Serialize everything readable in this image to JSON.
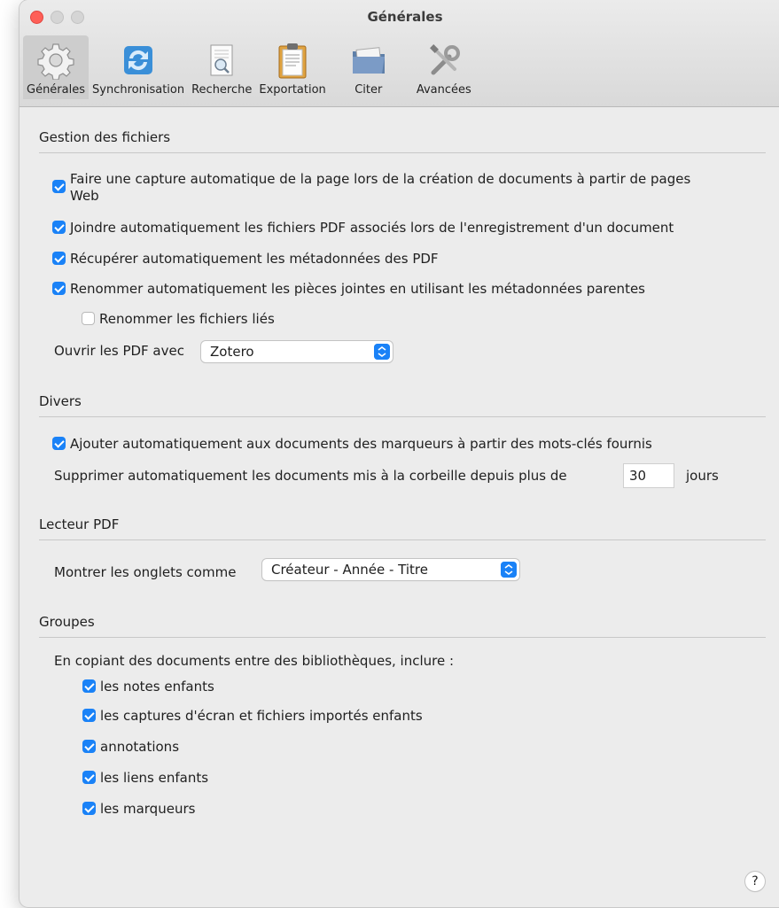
{
  "window": {
    "title": "Générales"
  },
  "toolbar": {
    "items": [
      {
        "label": "Générales",
        "icon": "gear-icon"
      },
      {
        "label": "Synchronisation",
        "icon": "sync-icon"
      },
      {
        "label": "Recherche",
        "icon": "search-document-icon"
      },
      {
        "label": "Exportation",
        "icon": "clipboard-icon"
      },
      {
        "label": "Citer",
        "icon": "folder-icon"
      },
      {
        "label": "Avancées",
        "icon": "tools-icon"
      }
    ]
  },
  "file_management": {
    "title": "Gestion des fichiers",
    "snapshot_line1": "Faire une capture automatique de la page lors de la création de documents à partir de pages",
    "snapshot_line2": "Web",
    "attach_pdf": "Joindre automatiquement les fichiers PDF associés lors de l'enregistrement d'un document",
    "retrieve_metadata": "Récupérer automatiquement les métadonnées des PDF",
    "rename_attachments": "Renommer automatiquement les pièces jointes en utilisant les métadonnées parentes",
    "rename_linked": "Renommer les fichiers liés",
    "open_pdf_label": "Ouvrir les PDF avec",
    "open_pdf_value": "Zotero"
  },
  "misc": {
    "title": "Divers",
    "auto_tags": "Ajouter automatiquement aux documents des marqueurs à partir des mots-clés fournis",
    "trash_prefix": "Supprimer automatiquement les documents mis à la corbeille depuis plus de",
    "trash_days": "30",
    "trash_suffix": "jours"
  },
  "pdf_reader": {
    "title": "Lecteur PDF",
    "tabs_label": "Montrer les onglets comme",
    "tabs_value": "Créateur - Année - Titre"
  },
  "groups": {
    "title": "Groupes",
    "copy_label": "En copiant des documents entre des bibliothèques, inclure :",
    "child_notes": "les notes enfants",
    "child_snapshots": "les captures d'écran et fichiers importés enfants",
    "annotations": "annotations",
    "child_links": "les liens enfants",
    "tags": "les marqueurs"
  },
  "help": {
    "label": "?"
  },
  "colors": {
    "accent": "#1a82f7",
    "close": "#fe5f57"
  }
}
